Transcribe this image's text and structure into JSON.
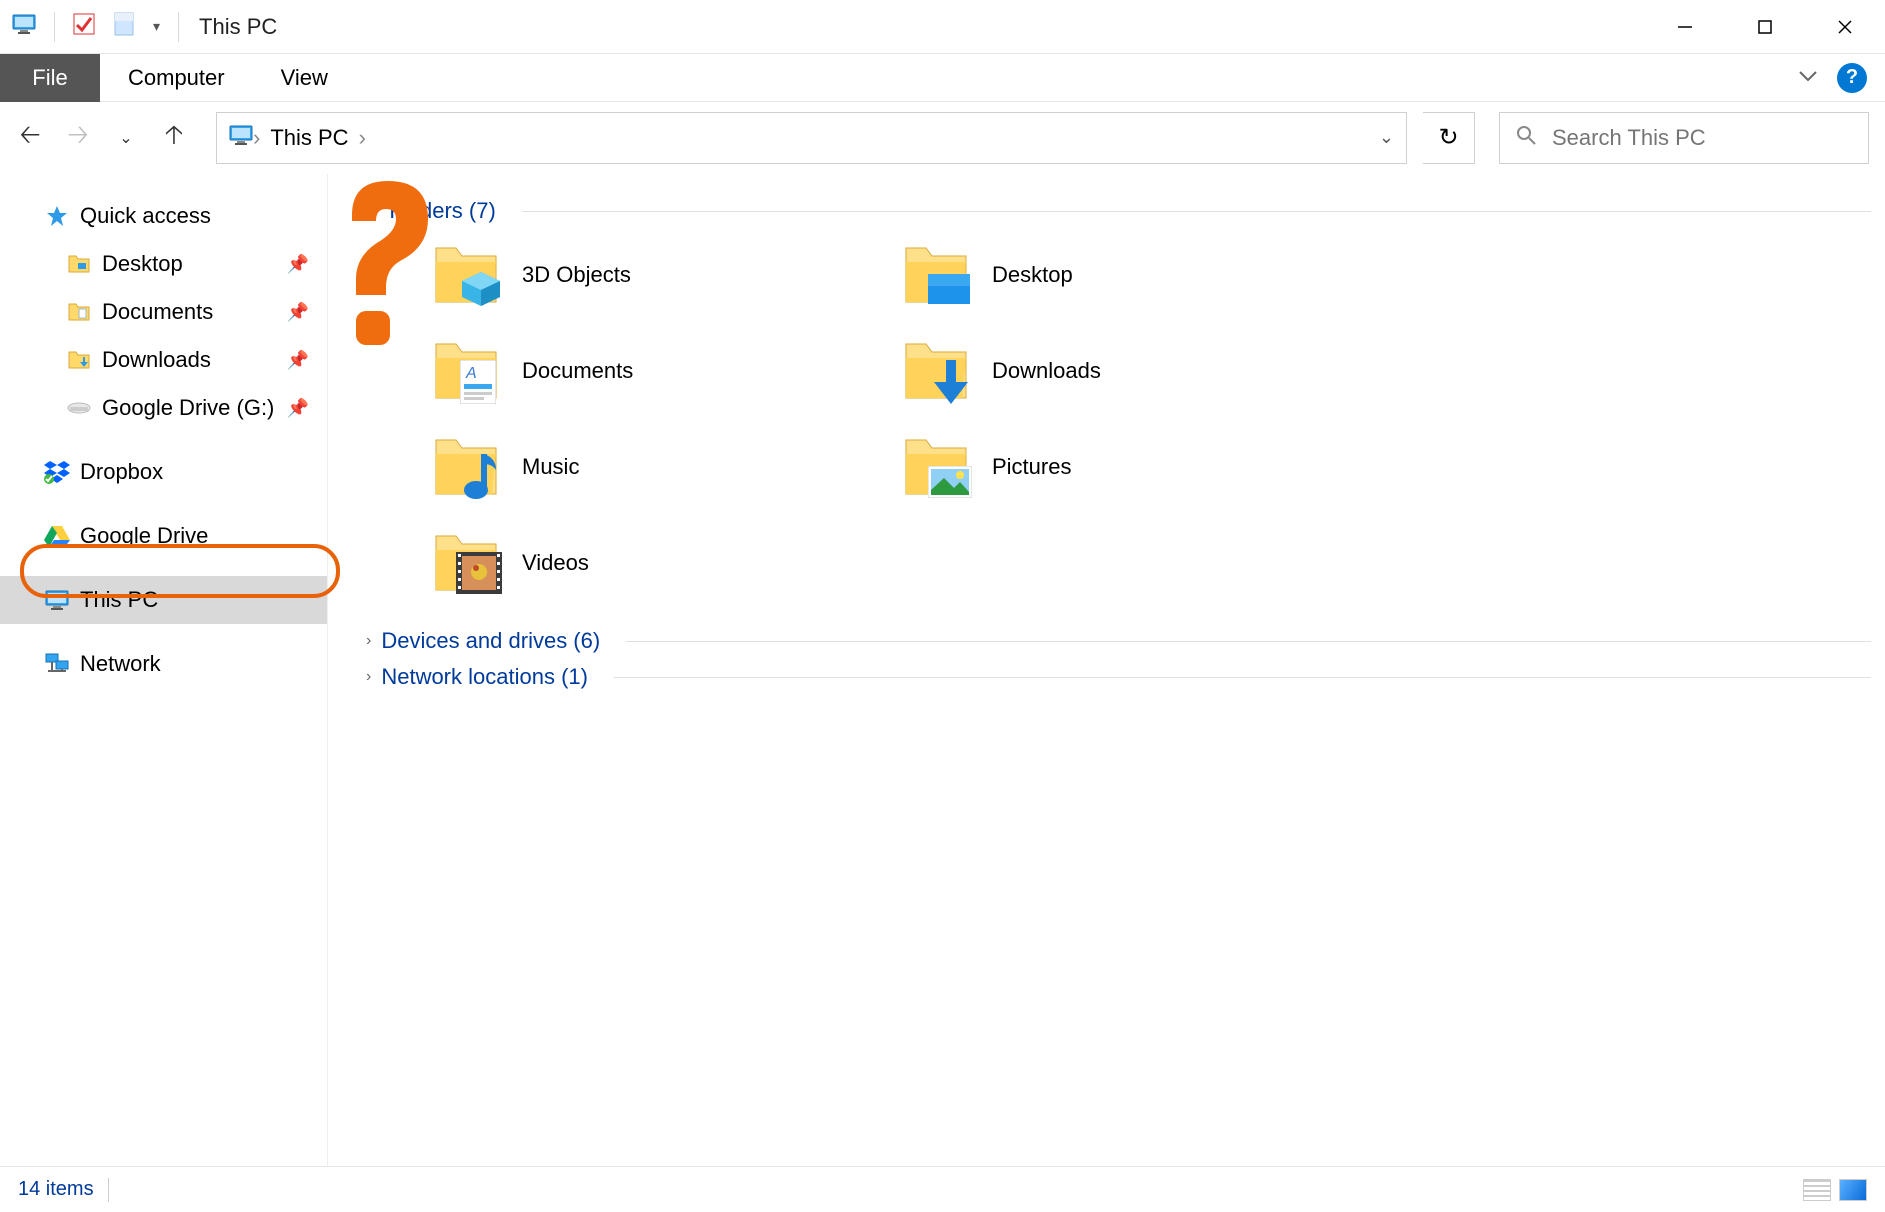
{
  "window": {
    "title": "This PC"
  },
  "ribbon": {
    "file": "File",
    "tabs": [
      "Computer",
      "View"
    ]
  },
  "nav": {
    "breadcrumb": "This PC",
    "search_placeholder": "Search This PC"
  },
  "sidebar": {
    "quick_access": "Quick access",
    "items": [
      {
        "label": "Desktop",
        "pinned": true,
        "icon": "desktop"
      },
      {
        "label": "Documents",
        "pinned": true,
        "icon": "documents"
      },
      {
        "label": "Downloads",
        "pinned": true,
        "icon": "downloads"
      },
      {
        "label": "Google Drive (G:)",
        "pinned": true,
        "icon": "drive"
      }
    ],
    "dropbox": "Dropbox",
    "gdrive": "Google Drive",
    "thispc": "This PC",
    "network": "Network"
  },
  "sections": {
    "folders": {
      "label": "Folders (7)",
      "expanded": true
    },
    "devices": {
      "label": "Devices and drives (6)",
      "expanded": false
    },
    "netloc": {
      "label": "Network locations (1)",
      "expanded": false
    }
  },
  "folders": [
    {
      "label": "3D Objects",
      "kind": "3d"
    },
    {
      "label": "Desktop",
      "kind": "desktop"
    },
    {
      "label": "Documents",
      "kind": "documents"
    },
    {
      "label": "Downloads",
      "kind": "downloads"
    },
    {
      "label": "Music",
      "kind": "music"
    },
    {
      "label": "Pictures",
      "kind": "pictures"
    },
    {
      "label": "Videos",
      "kind": "videos"
    }
  ],
  "statusbar": {
    "items": "14 items"
  }
}
